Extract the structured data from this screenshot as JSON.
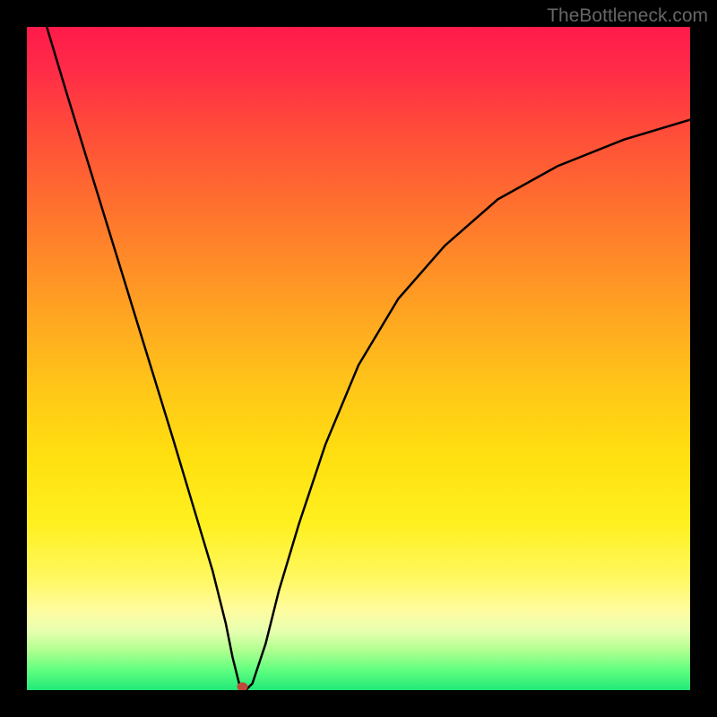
{
  "watermark": "TheBottleneck.com",
  "chart_data": {
    "type": "line",
    "title": "",
    "xlabel": "",
    "ylabel": "",
    "xlim": [
      0,
      100
    ],
    "ylim": [
      0,
      100
    ],
    "series": [
      {
        "name": "bottleneck-curve",
        "x": [
          3,
          6,
          10,
          14,
          18,
          22,
          25,
          28,
          30,
          31,
          32,
          33,
          34,
          36,
          38,
          41,
          45,
          50,
          56,
          63,
          71,
          80,
          90,
          100
        ],
        "y": [
          100,
          90,
          77,
          64,
          51,
          38,
          28,
          18,
          10,
          5,
          1,
          0,
          1,
          7,
          15,
          25,
          37,
          49,
          59,
          67,
          74,
          79,
          83,
          86
        ]
      }
    ],
    "marker": {
      "x": 32.5,
      "y": 0.5,
      "color": "#c04a3a"
    }
  }
}
